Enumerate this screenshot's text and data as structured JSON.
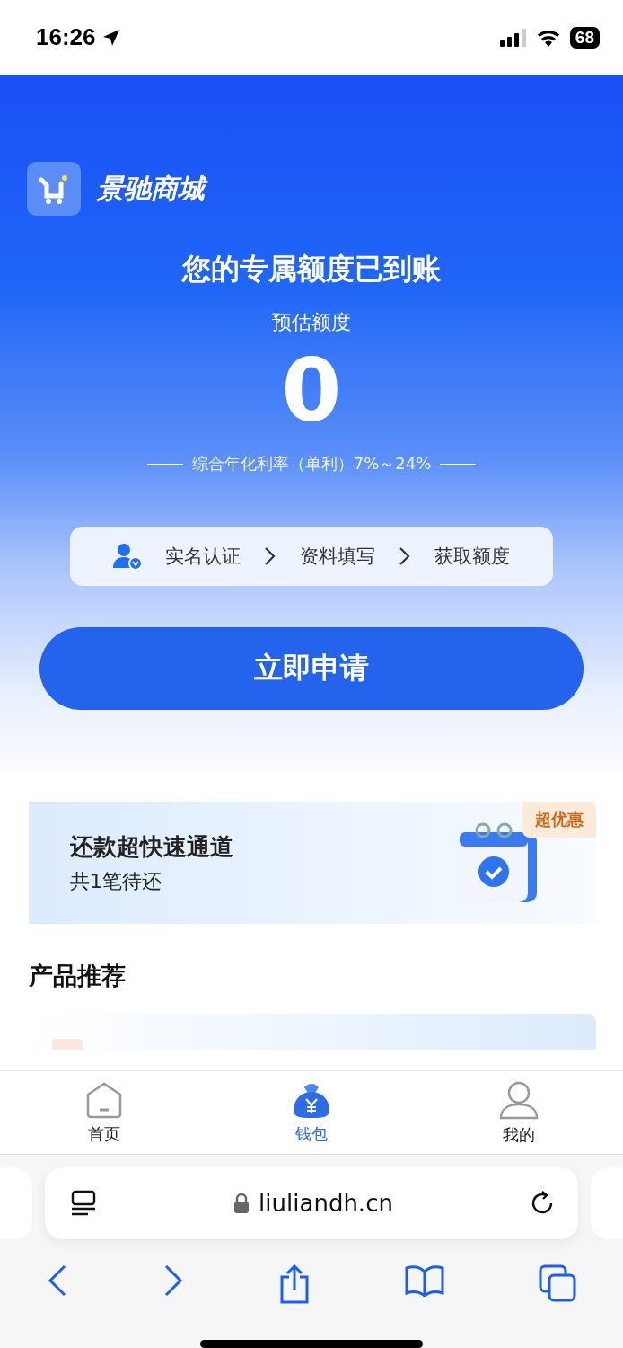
{
  "status_bar": {
    "time": "16:26",
    "battery": "68"
  },
  "brand": {
    "name": "景驰商城"
  },
  "hero": {
    "headline": "您的专属额度已到账",
    "amount_label": "预估额度",
    "amount": "0",
    "rate": "综合年化利率（单利）7%～24%"
  },
  "steps": [
    {
      "label": "实名认证"
    },
    {
      "label": "资料填写"
    },
    {
      "label": "获取额度"
    }
  ],
  "apply_button": "立即申请",
  "promo": {
    "title": "还款超快速通道",
    "subtitle": "共1笔待还",
    "badge": "超优惠"
  },
  "section_title": "产品推荐",
  "tabs": [
    {
      "label": "首页",
      "kind": "home",
      "selected": false
    },
    {
      "label": "钱包",
      "kind": "wallet",
      "selected": true
    },
    {
      "label": "我的",
      "kind": "profile",
      "selected": false
    }
  ],
  "browser": {
    "url": "liuliandh.cn"
  }
}
